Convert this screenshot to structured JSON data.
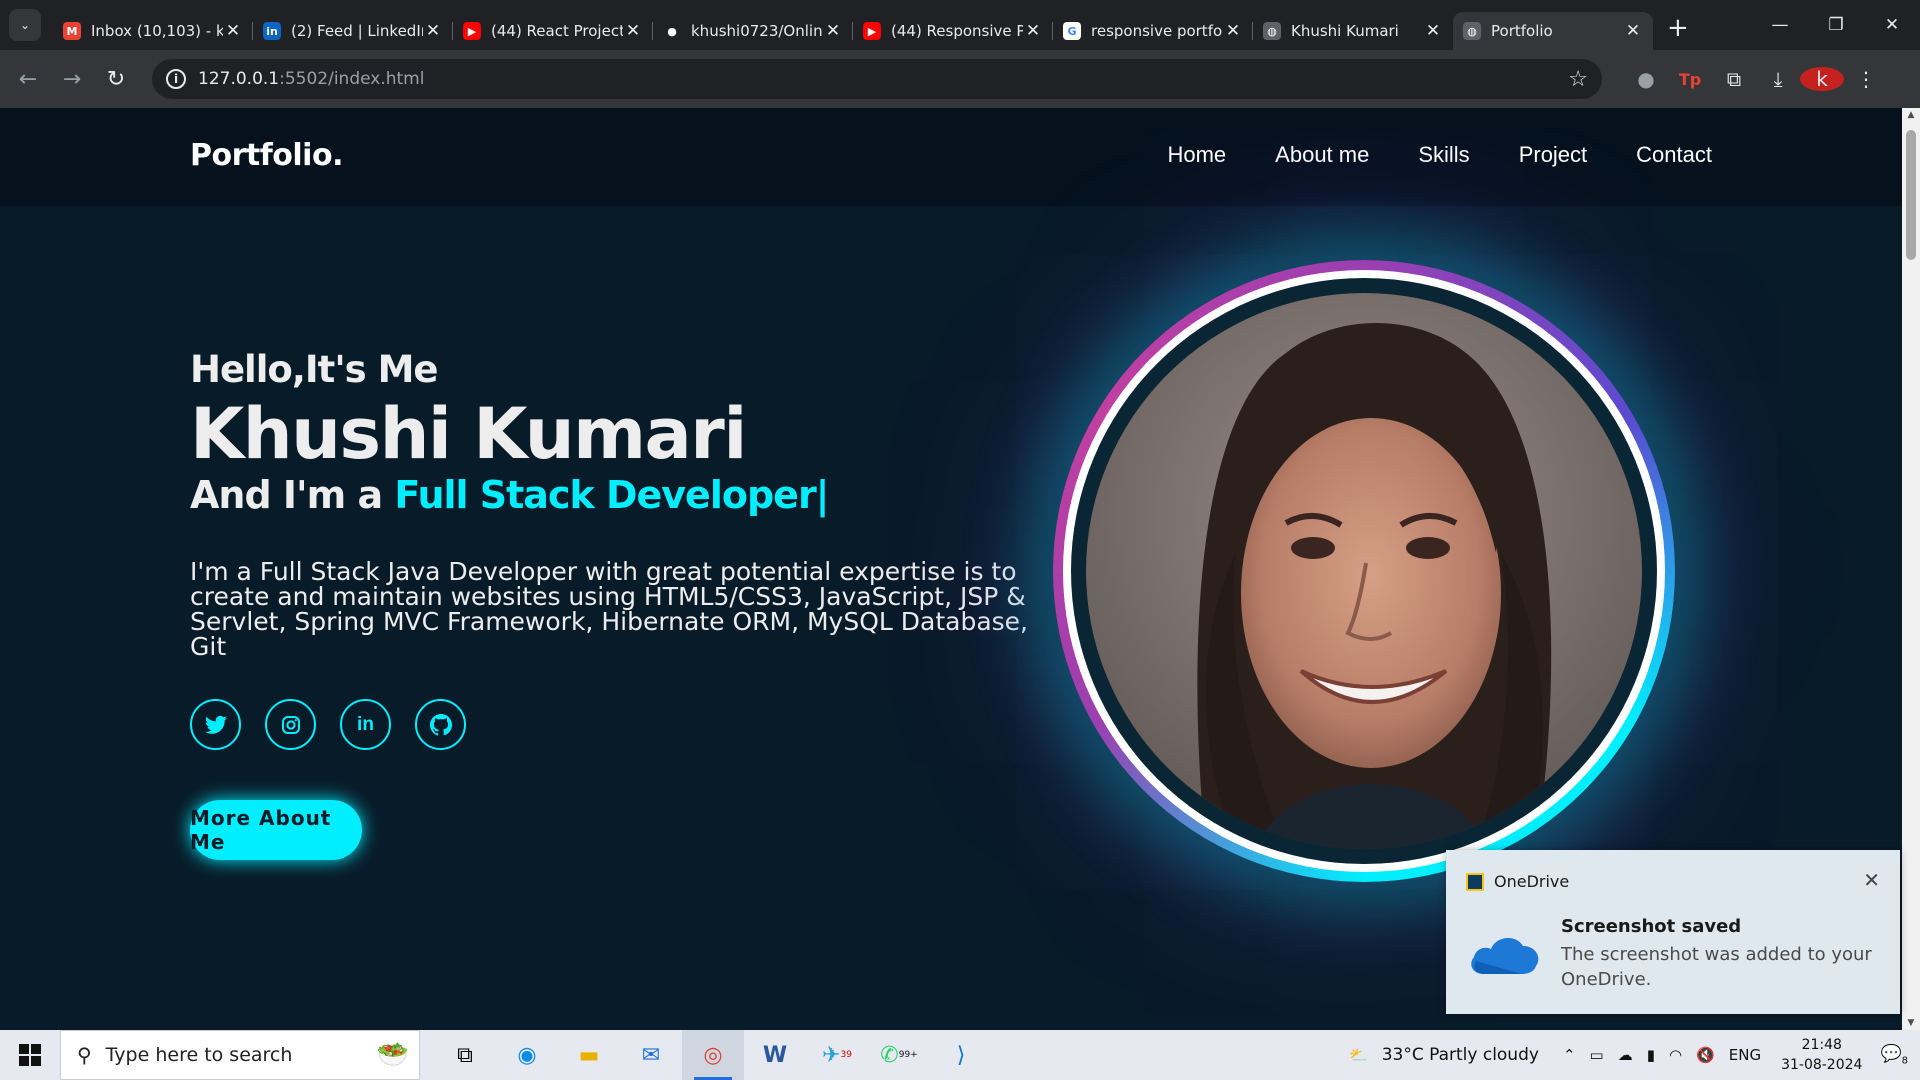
{
  "browser": {
    "tabs": [
      {
        "title": "Inbox (10,103) - k",
        "icon": "gmail-icon",
        "color": "#ea4335",
        "glyph": "M"
      },
      {
        "title": "(2) Feed | LinkedIn",
        "icon": "linkedin-icon",
        "color": "#0a66c2",
        "glyph": "in"
      },
      {
        "title": "(44) React Projects",
        "icon": "youtube-icon",
        "color": "#ff0000",
        "glyph": "▶"
      },
      {
        "title": "khushi0723/Online",
        "icon": "github-icon",
        "color": "#202124",
        "glyph": "●"
      },
      {
        "title": "(44) Responsive P",
        "icon": "youtube-icon",
        "color": "#ff0000",
        "glyph": "▶"
      },
      {
        "title": "responsive portfo",
        "icon": "google-icon",
        "color": "#ffffff",
        "glyph": "G"
      },
      {
        "title": "Khushi Kumari",
        "icon": "globe-icon",
        "color": "#5f6368",
        "glyph": "◍"
      },
      {
        "title": "Portfolio",
        "icon": "globe-icon",
        "color": "#5f6368",
        "glyph": "◍"
      }
    ],
    "url_host": "127.0.0.1",
    "url_rest": ":5502/index.html"
  },
  "site": {
    "logo": "Portfolio.",
    "nav": [
      "Home",
      "About me",
      "Skills",
      "Project",
      "Contact"
    ],
    "greeting": "Hello,It's Me",
    "name": "Khushi Kumari",
    "role_prefix": "And I'm a ",
    "role": "Full Stack Developer|",
    "description": "I'm a Full Stack Java Developer with great potential expertise is to create and maintain websites using HTML5/CSS3, JavaScript, JSP & Servlet, Spring MVC Framework, Hibernate ORM, MySQL Database, Git",
    "social": [
      "twitter-icon",
      "instagram-icon",
      "linkedin-icon",
      "github-icon"
    ],
    "button": "More About Me",
    "accent": "#00eeff",
    "bg": "#081b29"
  },
  "toast": {
    "app": "OneDrive",
    "title": "Screenshot saved",
    "body": "The screenshot was added to your OneDrive."
  },
  "taskbar": {
    "search_placeholder": "Type here to search",
    "weather": "33°C  Partly cloudy",
    "lang": "ENG",
    "time": "21:48",
    "date": "31-08-2024",
    "notif_count": "8",
    "telegram_badge": "39",
    "whatsapp_badge": "99+"
  }
}
